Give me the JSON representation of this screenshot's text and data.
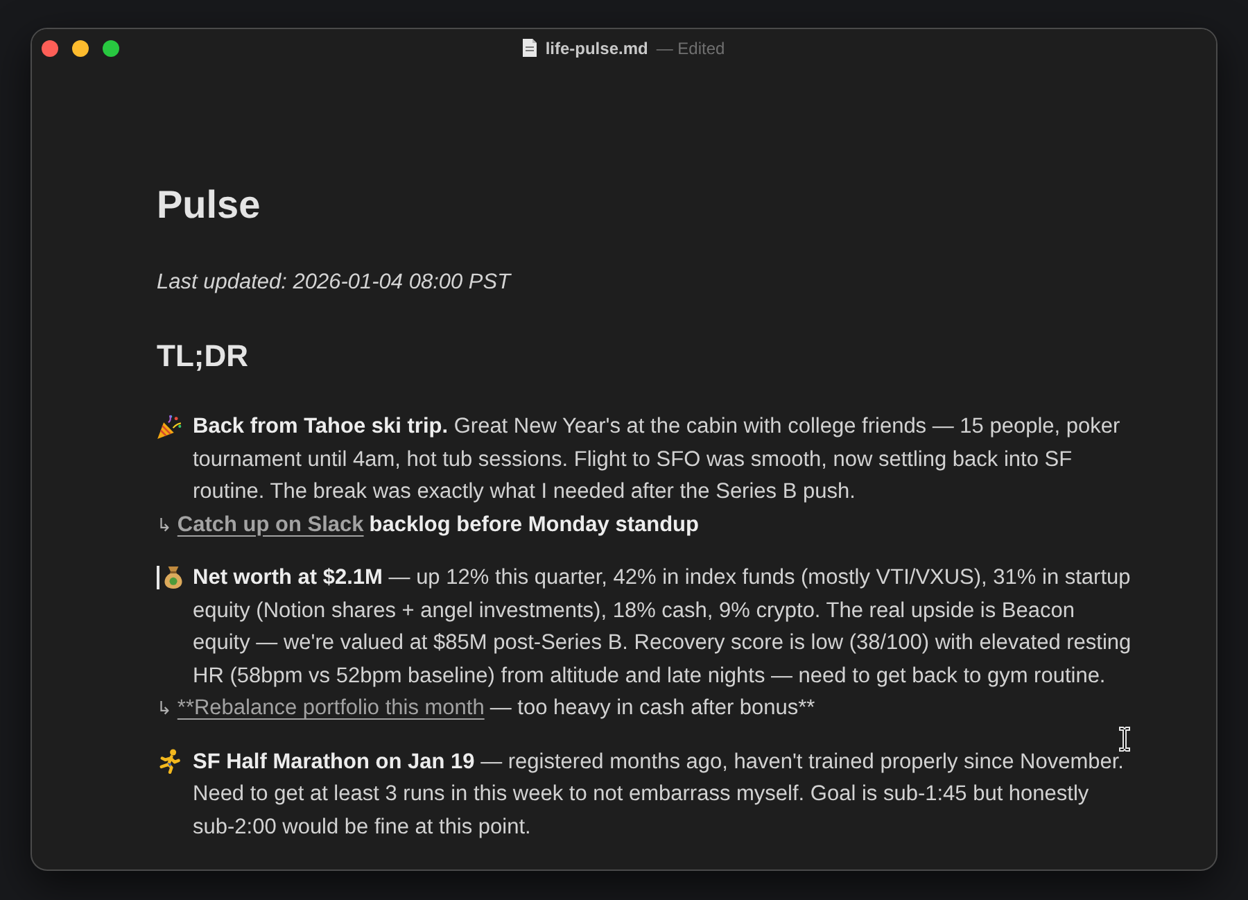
{
  "window": {
    "title": "life-pulse.md",
    "status": "— Edited"
  },
  "document": {
    "title": "Pulse",
    "updated": "Last updated: 2026-01-04 08:00 PST",
    "section": {
      "heading": "TL;DR",
      "items": [
        {
          "kind": "celebration",
          "caret": false,
          "text": "**Back from Tahoe ski trip.** Great New Year's at the cabin with college friends — 15 people, poker tournament until 4am, hot tub sessions. Flight to SFO was smooth, now settling back into SF routine. The break was exactly what I needed after the Series B push.",
          "followup": {
            "arrow": "↳",
            "link": "Catch up on Slack",
            "rest": "backlog before Monday standup",
            "bold": true
          }
        },
        {
          "kind": "money",
          "caret": true,
          "text": "**Net worth at $2.1M** — up 12% this quarter, 42% in index funds (mostly VTI/VXUS), 31% in startup equity (Notion shares + angel investments), 18% cash, 9% crypto. The real upside is Beacon equity — we're valued at $85M post-Series B. Recovery score is low (38/100) with elevated resting HR (58bpm vs 52bpm baseline) from altitude and late nights — need to get back to gym routine.",
          "followup": {
            "arrow": "↳",
            "link": "**Rebalance portfolio this month",
            "rest": "— too heavy in cash after bonus**",
            "bold": false
          }
        },
        {
          "kind": "running",
          "caret": false,
          "text": "**SF Half Marathon on Jan 19** — registered months ago, haven't trained properly since November. Need to get at least 3 runs in this week to not embarrass myself. Goal is sub-1:45 but honestly sub-2:00 would be fine at this point."
        }
      ]
    }
  }
}
